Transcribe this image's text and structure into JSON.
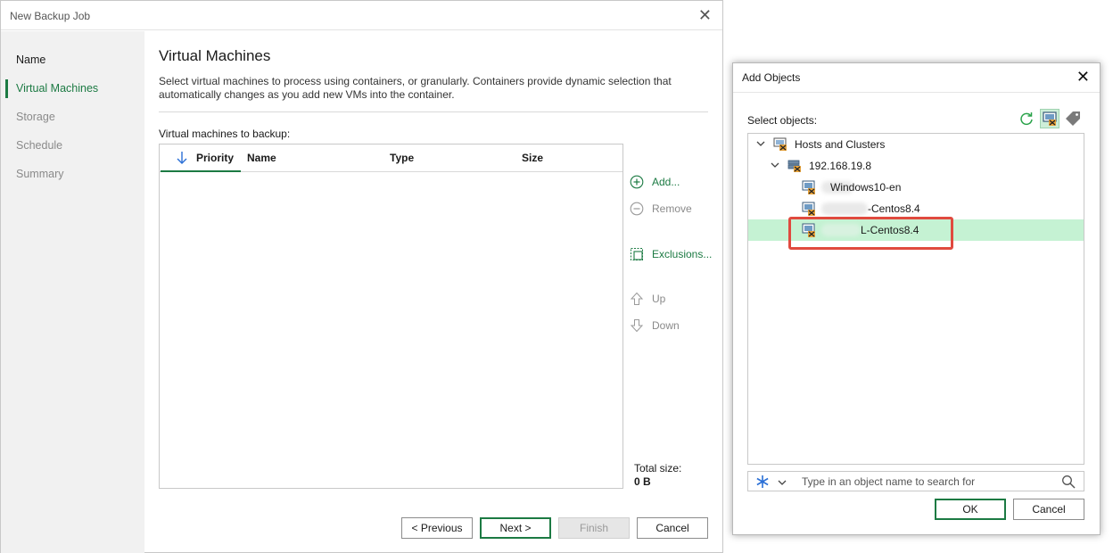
{
  "wizard": {
    "title": "New Backup Job",
    "steps": [
      {
        "label": "Name",
        "state": "done"
      },
      {
        "label": "Virtual Machines",
        "state": "active"
      },
      {
        "label": "Storage",
        "state": "pending"
      },
      {
        "label": "Schedule",
        "state": "pending"
      },
      {
        "label": "Summary",
        "state": "pending"
      }
    ],
    "heading": "Virtual Machines",
    "description": "Select virtual machines to process using containers, or granularly. Containers provide dynamic selection that automatically changes as you add new VMs into the container.",
    "list_label": "Virtual machines to backup:",
    "columns": [
      "Priority",
      "Name",
      "Type",
      "Size"
    ],
    "actions": {
      "add": "Add...",
      "remove": "Remove",
      "exclusions": "Exclusions...",
      "up": "Up",
      "down": "Down"
    },
    "total_label": "Total size:",
    "total_value": "0 B",
    "buttons": {
      "previous": "< Previous",
      "next": "Next >",
      "finish": "Finish",
      "cancel": "Cancel"
    }
  },
  "dialog": {
    "title": "Add Objects",
    "select_label": "Select objects:",
    "tree": [
      {
        "label": "Hosts and Clusters",
        "icon": "hosts-and-clusters-icon",
        "expanded": true
      },
      {
        "label": "192.168.19.8",
        "icon": "host-server-icon",
        "expanded": true
      },
      {
        "label": "Windows10-en",
        "icon": "virtual-machine-icon"
      },
      {
        "label": "-Centos8.4",
        "icon": "virtual-machine-icon"
      },
      {
        "label": "L-Centos8.4",
        "icon": "virtual-machine-icon",
        "selected": true
      }
    ],
    "search_placeholder": "Type in an object name to search for",
    "buttons": {
      "ok": "OK",
      "cancel": "Cancel"
    }
  },
  "colors": {
    "accent_green": "#1c7a43",
    "selection_green": "#c5f2d3",
    "highlight_red": "#e04a3f"
  }
}
